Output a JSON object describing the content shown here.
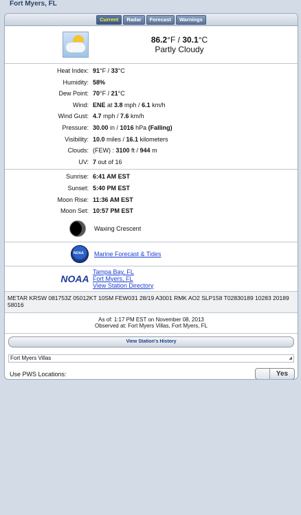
{
  "header": {
    "location": "Fort Myers, FL"
  },
  "tabs": [
    {
      "label": "Current",
      "active": true
    },
    {
      "label": "Radar",
      "active": false
    },
    {
      "label": "Forecast",
      "active": false
    },
    {
      "label": "Warnings",
      "active": false
    }
  ],
  "current": {
    "temp_f": "86.2",
    "temp_c": "30.1",
    "condition": "Partly Cloudy",
    "icon": "partly-cloudy-icon"
  },
  "details": [
    {
      "label": "Heat Index:",
      "value": "91°F / 33°C"
    },
    {
      "label": "Humidity:",
      "value": "58%"
    },
    {
      "label": "Dew Point:",
      "value": "70°F / 21°C"
    },
    {
      "label": "Wind:",
      "value": "ENE at 3.8 mph / 6.1 km/h"
    },
    {
      "label": "Wind Gust:",
      "value": "4.7 mph / 7.6 km/h"
    },
    {
      "label": "Pressure:",
      "value": "30.00 in / 1016 hPa (Falling)"
    },
    {
      "label": "Visibility:",
      "value": "10.0 miles / 16.1 kilometers"
    },
    {
      "label": "Clouds:",
      "value": "(FEW) : 3100 ft / 944 m"
    },
    {
      "label": "UV:",
      "value": "7 out of 16"
    }
  ],
  "astronomy": [
    {
      "label": "Sunrise:",
      "value": "6:41 AM EST"
    },
    {
      "label": "Sunset:",
      "value": "5:40 PM EST"
    },
    {
      "label": "Moon Rise:",
      "value": "11:36 AM EST"
    },
    {
      "label": "Moon Set:",
      "value": "10:57 PM EST"
    }
  ],
  "moon_phase": "Waxing Crescent",
  "marine_link": "Marine Forecast & Tides",
  "noaa": {
    "logo_text": "NOAA",
    "links": [
      "Tampa Bay, FL",
      "Fort Myers, FL",
      "View Station Directory"
    ]
  },
  "metar": "METAR KRSW 081753Z 05012KT 10SM FEW031 28/19 A3001 RMK AO2 SLP158 T02830189 10283 20189 58016",
  "asof": "As of: 1:17 PM EST on November 08, 2013",
  "observed_at": "Observed at: Fort Myers Villas, Fort Myers, FL",
  "history_button": "View Station's History",
  "station_select": "Fort Myers Villas",
  "pws": {
    "label": "Use PWS Locations:",
    "toggle": "Yes"
  }
}
